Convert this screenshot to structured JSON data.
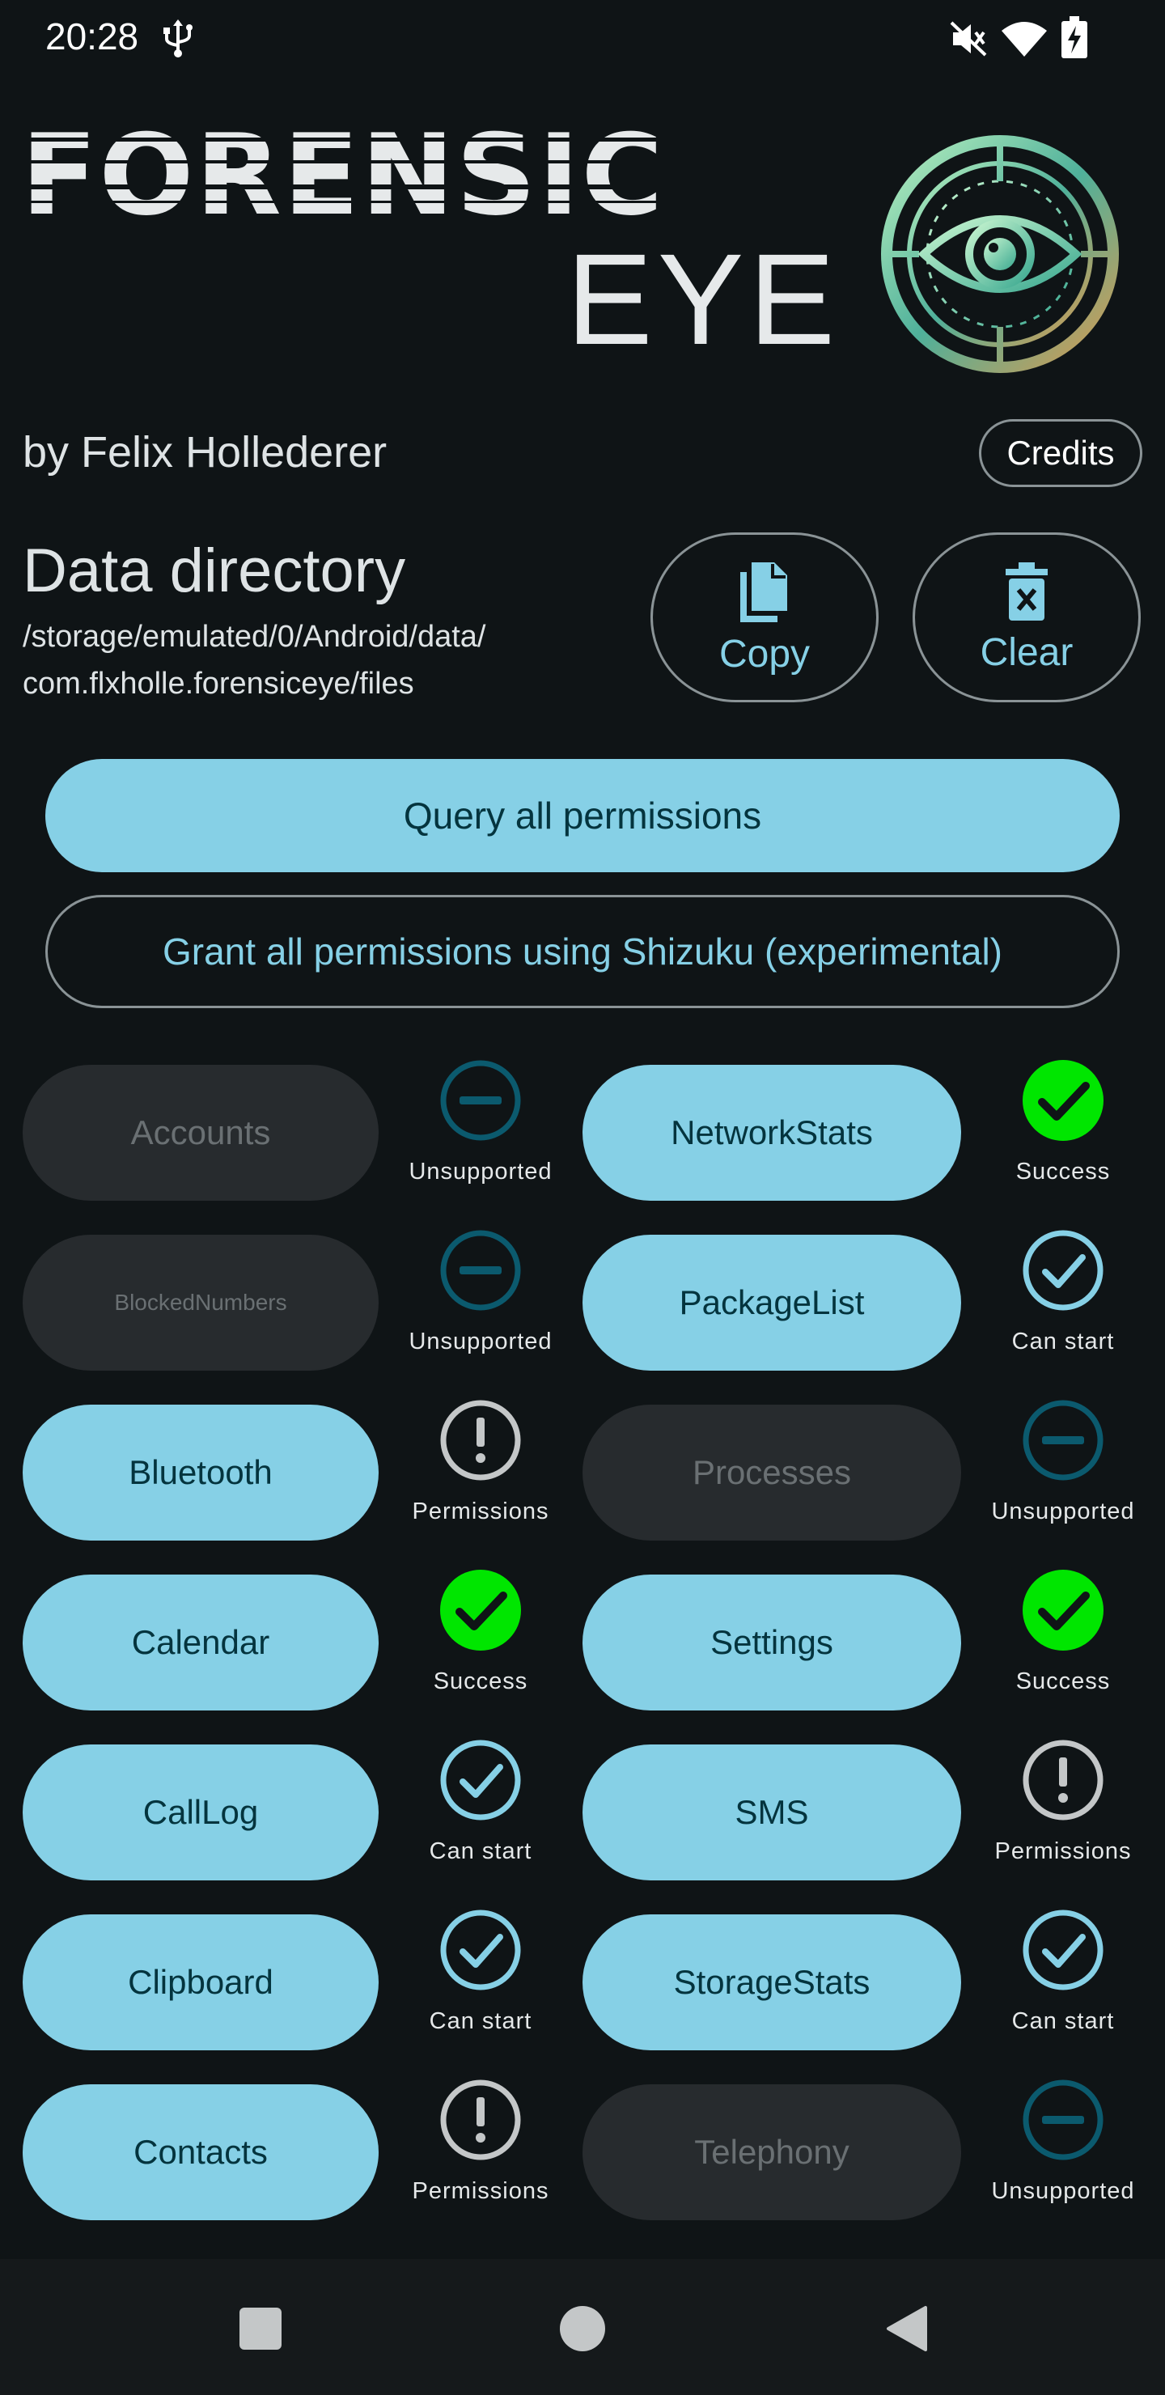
{
  "status_bar": {
    "time": "20:28",
    "icons": [
      "usb-icon",
      "mute-icon",
      "wifi-icon",
      "battery-charging-icon"
    ]
  },
  "header": {
    "logo_title": "FORENSIC",
    "logo_subtitle": "EYE",
    "author": "by Felix Hollederer",
    "credits_label": "Credits"
  },
  "data_directory": {
    "title": "Data directory",
    "path_line1": "/storage/emulated/0/Android/data/",
    "path_line2": "com.flxholle.forensiceye/files",
    "copy_label": "Copy",
    "clear_label": "Clear"
  },
  "actions": {
    "query_label": "Query all permissions",
    "grant_label": "Grant all permissions using Shizuku (experimental)"
  },
  "modules": {
    "left": [
      {
        "name": "Accounts",
        "enabled": false,
        "status": "Unsupported",
        "status_kind": "unsupported"
      },
      {
        "name": "BlockedNumbers",
        "enabled": false,
        "status": "Unsupported",
        "status_kind": "unsupported"
      },
      {
        "name": "Bluetooth",
        "enabled": true,
        "status": "Permissions",
        "status_kind": "permissions"
      },
      {
        "name": "Calendar",
        "enabled": true,
        "status": "Success",
        "status_kind": "success"
      },
      {
        "name": "CallLog",
        "enabled": true,
        "status": "Can start",
        "status_kind": "canstart"
      },
      {
        "name": "Clipboard",
        "enabled": true,
        "status": "Can start",
        "status_kind": "canstart"
      },
      {
        "name": "Contacts",
        "enabled": true,
        "status": "Permissions",
        "status_kind": "permissions"
      }
    ],
    "right": [
      {
        "name": "NetworkStats",
        "enabled": true,
        "status": "Success",
        "status_kind": "success"
      },
      {
        "name": "PackageList",
        "enabled": true,
        "status": "Can start",
        "status_kind": "canstart"
      },
      {
        "name": "Processes",
        "enabled": false,
        "status": "Unsupported",
        "status_kind": "unsupported"
      },
      {
        "name": "Settings",
        "enabled": true,
        "status": "Success",
        "status_kind": "success"
      },
      {
        "name": "SMS",
        "enabled": true,
        "status": "Permissions",
        "status_kind": "permissions"
      },
      {
        "name": "StorageStats",
        "enabled": true,
        "status": "Can start",
        "status_kind": "canstart"
      },
      {
        "name": "Telephony",
        "enabled": false,
        "status": "Unsupported",
        "status_kind": "unsupported"
      }
    ]
  },
  "colors": {
    "background": "#0f1416",
    "accent": "#86d0e6",
    "success": "#00e600",
    "unsupported": "#0b5a6e",
    "permissions": "#c4c7c8",
    "disabled": "#272b2e"
  },
  "nav_bar": {
    "icons": [
      "recents-icon",
      "home-icon",
      "back-icon"
    ]
  }
}
